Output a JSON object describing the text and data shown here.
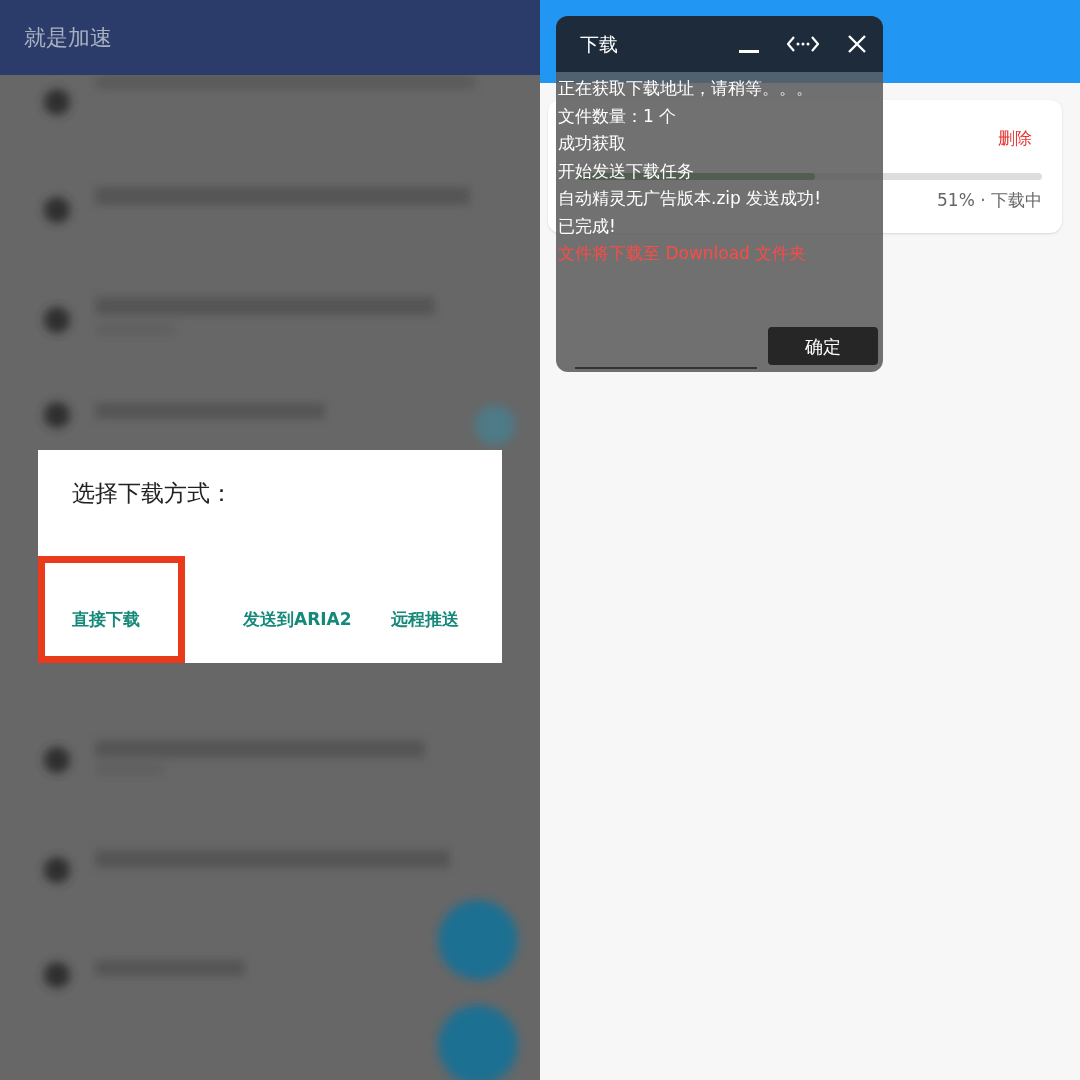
{
  "left": {
    "app_bar": {
      "title": "就是加速"
    },
    "dialog": {
      "title": "选择下载方式：",
      "buttons": [
        {
          "label": "直接下载",
          "selected": true
        },
        {
          "label": "发送到ARIA2",
          "selected": false
        },
        {
          "label": "远程推送",
          "selected": false
        }
      ]
    }
  },
  "right": {
    "task_card": {
      "action": "删除",
      "level": 0.51,
      "status": "51% · 下载中"
    },
    "float_window": {
      "title": "下载",
      "log": [
        {
          "text": "正在获取下载地址，请稍等。。。",
          "kind": "info"
        },
        {
          "text": "文件数量：1 个",
          "kind": "info"
        },
        {
          "text": "成功获取",
          "kind": "info"
        },
        {
          "text": "开始发送下载任务",
          "kind": "info"
        },
        {
          "text": "自动精灵无广告版本.zip 发送成功!",
          "kind": "info"
        },
        {
          "text": "已完成!",
          "kind": "info"
        },
        {
          "text": "文件将下载至 Download 文件夹",
          "kind": "notice"
        }
      ],
      "ok": "确定"
    }
  }
}
